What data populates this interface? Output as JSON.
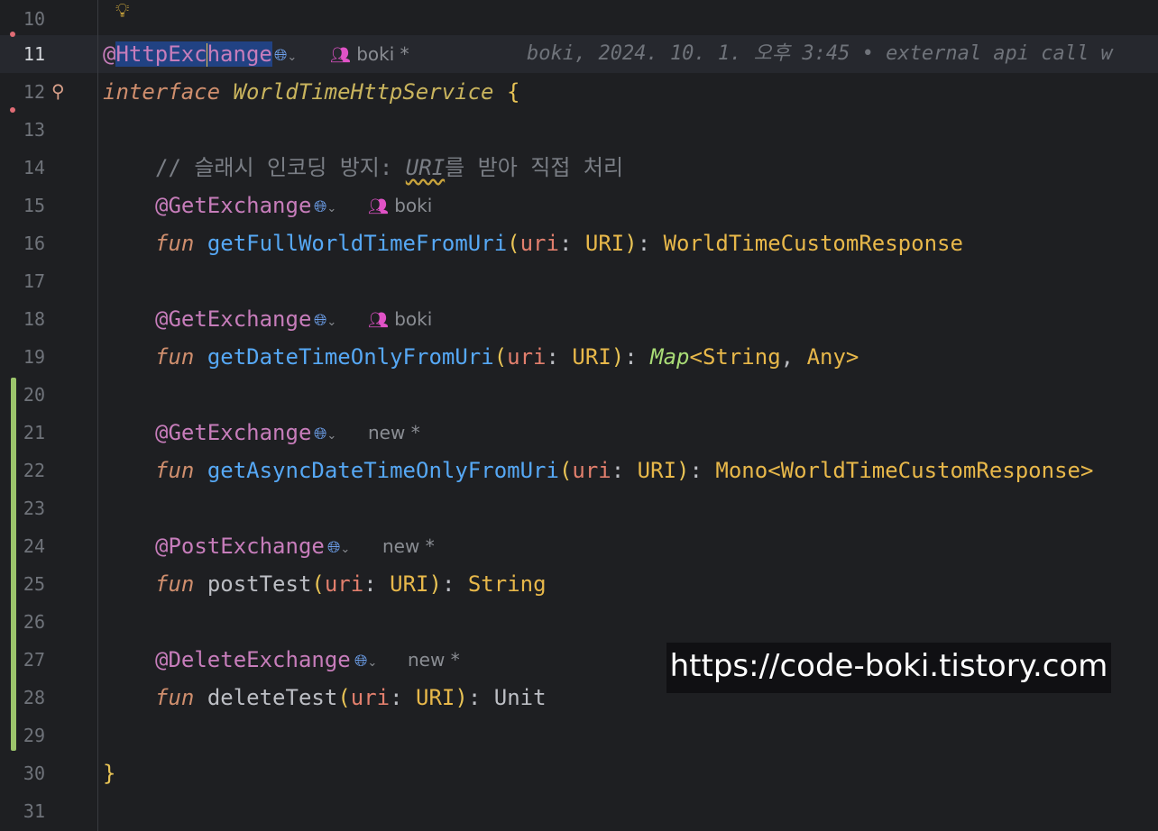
{
  "blame": {
    "line11_author": "boki *",
    "line11_detail": "boki, 2024. 10. 1. 오후 3:45 • external api call w"
  },
  "inlays": {
    "l15": "boki",
    "l18": "boki",
    "l21": "new *",
    "l24": "new *",
    "l27": "new *"
  },
  "watermark": "https://code-boki.tistory.com",
  "colors": {
    "background": "#1e1f22",
    "annotation": "#c77dbb",
    "function": "#56a8f5",
    "parameter": "#e27f6d",
    "type": "#e8b84a",
    "change_bar": "#9cc46b"
  },
  "icons": [
    "lightbulb-icon",
    "spring-bean-icon",
    "globe-icon",
    "people-icon",
    "chevron-down-icon"
  ],
  "lines": [
    {
      "n": "10"
    },
    {
      "n": "11"
    },
    {
      "n": "12"
    },
    {
      "n": "13"
    },
    {
      "n": "14"
    },
    {
      "n": "15"
    },
    {
      "n": "16"
    },
    {
      "n": "17"
    },
    {
      "n": "18"
    },
    {
      "n": "19"
    },
    {
      "n": "20"
    },
    {
      "n": "21"
    },
    {
      "n": "22"
    },
    {
      "n": "23"
    },
    {
      "n": "24"
    },
    {
      "n": "25"
    },
    {
      "n": "26"
    },
    {
      "n": "27"
    },
    {
      "n": "28"
    },
    {
      "n": "29"
    },
    {
      "n": "30"
    },
    {
      "n": "31"
    }
  ],
  "code": {
    "l11": {
      "at": "@",
      "ann_a": "HttpExc",
      "ann_b": "hange"
    },
    "l12": {
      "kw": "interface",
      "name": "WorldTimeHttpService",
      "brace": "{"
    },
    "l14": {
      "prefix": "// 슬래시 인코딩 방지: ",
      "uri": "URI",
      "suffix": "를 받아 직접 처리"
    },
    "l15": {
      "ann": "@GetExchange"
    },
    "l16": {
      "kw": "fun",
      "fn": "getFullWorldTimeFromUri",
      "param": "uri",
      "ptype": "URI",
      "ret": "WorldTimeCustomResponse"
    },
    "l18": {
      "ann": "@GetExchange"
    },
    "l19": {
      "kw": "fun",
      "fn": "getDateTimeOnlyFromUri",
      "param": "uri",
      "ptype": "URI",
      "map": "Map",
      "t1": "String",
      "t2": "Any"
    },
    "l21": {
      "ann": "@GetExchange"
    },
    "l22": {
      "kw": "fun",
      "fn": "getAsyncDateTimeOnlyFromUri",
      "param": "uri",
      "ptype": "URI",
      "ret": "Mono<WorldTimeCustomResponse>"
    },
    "l24": {
      "ann": "@PostExchange"
    },
    "l25": {
      "kw": "fun",
      "fn": "postTest",
      "param": "uri",
      "ptype": "URI",
      "ret": "String"
    },
    "l27": {
      "ann": "@DeleteExchange"
    },
    "l28": {
      "kw": "fun",
      "fn": "deleteTest",
      "param": "uri",
      "ptype": "URI",
      "ret": "Unit"
    },
    "l30": {
      "brace": "}"
    }
  }
}
